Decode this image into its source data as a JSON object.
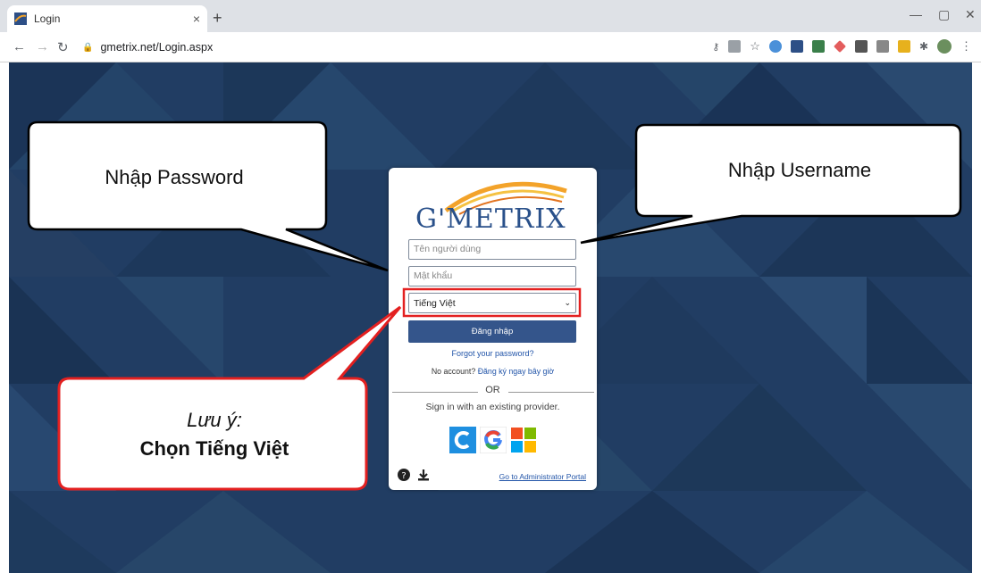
{
  "browser": {
    "tab_title": "Login",
    "tab_close": "×",
    "new_tab": "+",
    "url": "gmetrix.net/Login.aspx",
    "win_min": "—",
    "win_max": "▢",
    "win_close": "✕"
  },
  "card": {
    "logo_text": "G'METRIX",
    "username_placeholder": "Tên người dùng",
    "password_placeholder": "Mật khẩu",
    "language_value": "Tiếng Việt",
    "login_label": "Đăng nhập",
    "forgot_label": "Forgot your password?",
    "no_account_label": "No account?",
    "register_label": "Đăng ký ngay bây giờ",
    "or_label": "OR",
    "provider_text": "Sign in with an existing provider.",
    "admin_portal_label": "Go to Administrator Portal"
  },
  "callouts": {
    "password": "Nhập Password",
    "username": "Nhập Username",
    "note_line1": "Lưu ý:",
    "note_line2": "Chọn Tiếng Việt"
  },
  "colors": {
    "page_bg": "#1f3a5f",
    "brand_blue": "#34558b",
    "highlight_red": "#e32020"
  }
}
